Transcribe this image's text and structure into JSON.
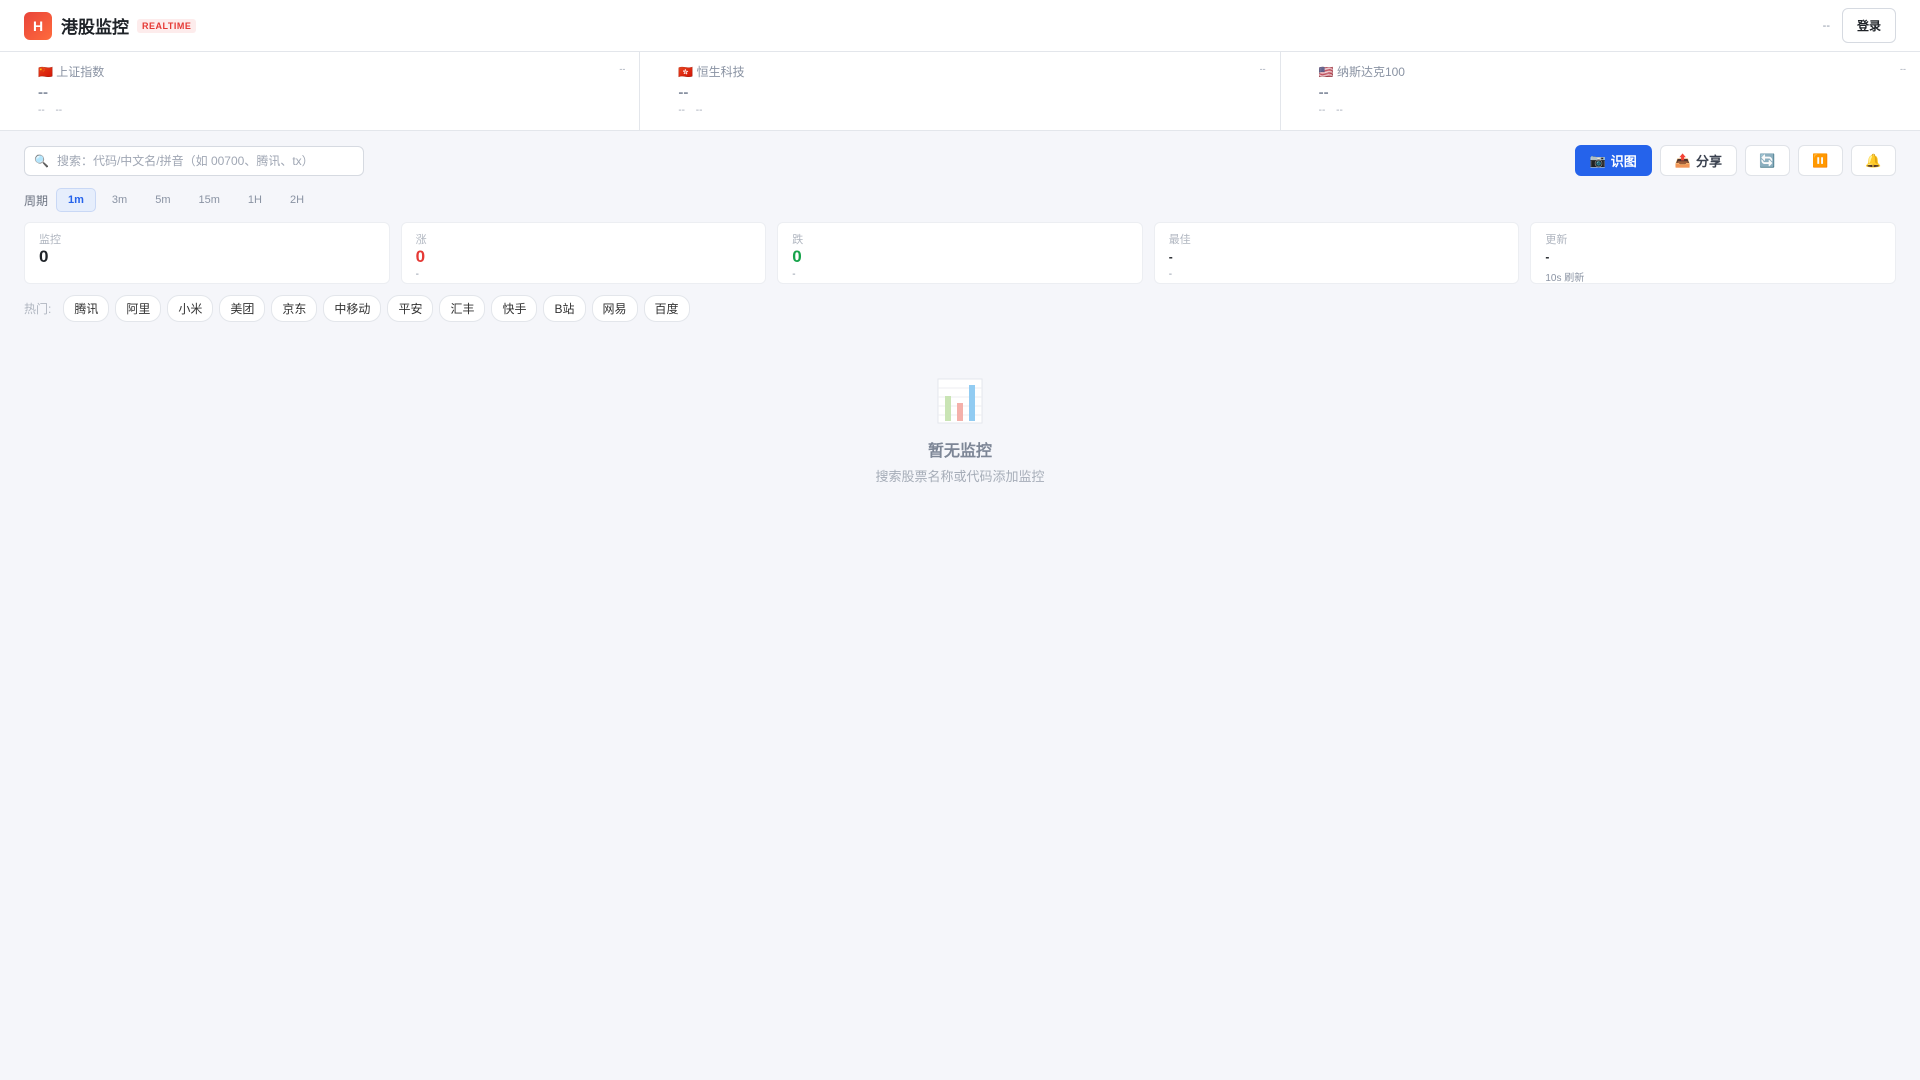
{
  "header": {
    "logo_letter": "H",
    "title": "港股监控",
    "badge": "REALTIME",
    "status": "--",
    "login": "登录"
  },
  "indices": [
    {
      "flag": "🇨🇳",
      "name": "上证指数",
      "time": "--",
      "value": "--",
      "change": "--",
      "pct": "--"
    },
    {
      "flag": "🇭🇰",
      "name": "恒生科技",
      "time": "--",
      "value": "--",
      "change": "--",
      "pct": "--"
    },
    {
      "flag": "🇺🇸",
      "name": "纳斯达克100",
      "time": "--",
      "value": "--",
      "change": "--",
      "pct": "--"
    }
  ],
  "search": {
    "placeholder": "搜索：代码/中文名/拼音（如 00700、腾讯、tx）"
  },
  "toolbar": {
    "recognize": "识图",
    "share": "分享"
  },
  "period": {
    "label": "周期",
    "options": [
      "1m",
      "3m",
      "5m",
      "15m",
      "1H",
      "2H"
    ],
    "selected": "1m"
  },
  "stats": [
    {
      "label": "监控",
      "value": "0",
      "sub": ""
    },
    {
      "label": "涨",
      "value": "0",
      "sub": "-"
    },
    {
      "label": "跌",
      "value": "0",
      "sub": "-"
    },
    {
      "label": "最佳",
      "value": "-",
      "sub": "-"
    },
    {
      "label": "更新",
      "value": "-",
      "sub": "10s 刷新"
    }
  ],
  "hot": {
    "label": "热门:",
    "tags": [
      "腾讯",
      "阿里",
      "小米",
      "美团",
      "京东",
      "中移动",
      "平安",
      "汇丰",
      "快手",
      "B站",
      "网易",
      "百度"
    ]
  },
  "empty": {
    "title": "暂无监控",
    "subtitle": "搜索股票名称或代码添加监控"
  },
  "colors": {
    "up": "#e53935",
    "down": "#16a34a",
    "primary": "#2563eb"
  }
}
